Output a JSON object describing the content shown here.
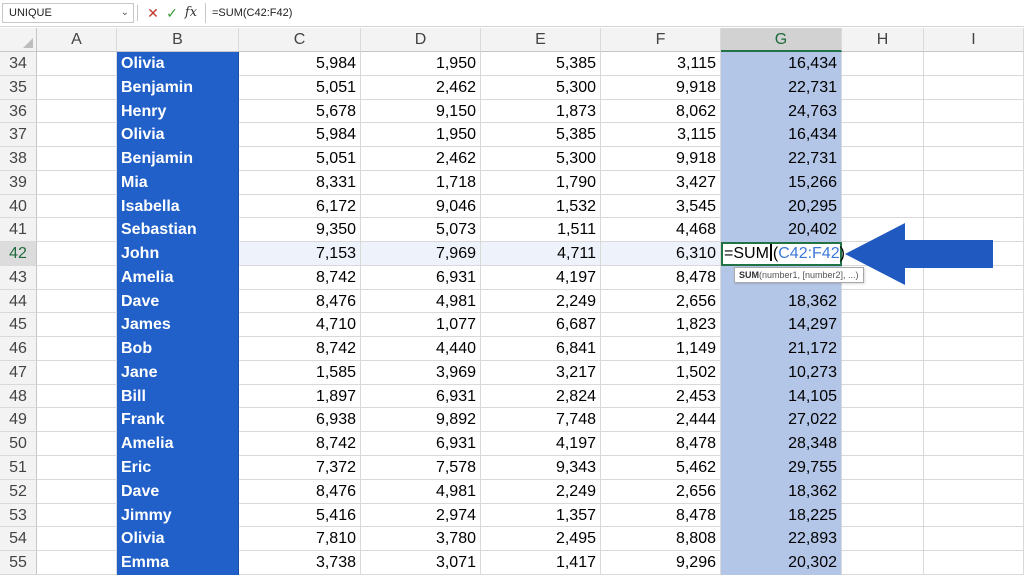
{
  "formula_bar": {
    "name_box": "UNIQUE",
    "cancel_icon": "✕",
    "enter_icon": "✓",
    "fx_label": "fx",
    "formula": "=SUM(C42:F42)"
  },
  "columns": [
    "A",
    "B",
    "C",
    "D",
    "E",
    "F",
    "G",
    "H",
    "I"
  ],
  "selected_column": "G",
  "selected_row": "42",
  "rows": [
    {
      "num": "34",
      "name": "Olivia",
      "c": "5,984",
      "d": "1,950",
      "e": "5,385",
      "f": "3,115",
      "g": "16,434"
    },
    {
      "num": "35",
      "name": "Benjamin",
      "c": "5,051",
      "d": "2,462",
      "e": "5,300",
      "f": "9,918",
      "g": "22,731"
    },
    {
      "num": "36",
      "name": "Henry",
      "c": "5,678",
      "d": "9,150",
      "e": "1,873",
      "f": "8,062",
      "g": "24,763"
    },
    {
      "num": "37",
      "name": "Olivia",
      "c": "5,984",
      "d": "1,950",
      "e": "5,385",
      "f": "3,115",
      "g": "16,434"
    },
    {
      "num": "38",
      "name": "Benjamin",
      "c": "5,051",
      "d": "2,462",
      "e": "5,300",
      "f": "9,918",
      "g": "22,731"
    },
    {
      "num": "39",
      "name": "Mia",
      "c": "8,331",
      "d": "1,718",
      "e": "1,790",
      "f": "3,427",
      "g": "15,266"
    },
    {
      "num": "40",
      "name": "Isabella",
      "c": "6,172",
      "d": "9,046",
      "e": "1,532",
      "f": "3,545",
      "g": "20,295"
    },
    {
      "num": "41",
      "name": "Sebastian",
      "c": "9,350",
      "d": "5,073",
      "e": "1,511",
      "f": "4,468",
      "g": "20,402"
    },
    {
      "num": "42",
      "name": "John",
      "c": "7,153",
      "d": "7,969",
      "e": "4,711",
      "f": "6,310",
      "g": ""
    },
    {
      "num": "43",
      "name": "Amelia",
      "c": "8,742",
      "d": "6,931",
      "e": "4,197",
      "f": "8,478",
      "g": ""
    },
    {
      "num": "44",
      "name": "Dave",
      "c": "8,476",
      "d": "4,981",
      "e": "2,249",
      "f": "2,656",
      "g": "18,362"
    },
    {
      "num": "45",
      "name": "James",
      "c": "4,710",
      "d": "1,077",
      "e": "6,687",
      "f": "1,823",
      "g": "14,297"
    },
    {
      "num": "46",
      "name": "Bob",
      "c": "8,742",
      "d": "4,440",
      "e": "6,841",
      "f": "1,149",
      "g": "21,172"
    },
    {
      "num": "47",
      "name": "Jane",
      "c": "1,585",
      "d": "3,969",
      "e": "3,217",
      "f": "1,502",
      "g": "10,273"
    },
    {
      "num": "48",
      "name": "Bill",
      "c": "1,897",
      "d": "6,931",
      "e": "2,824",
      "f": "2,453",
      "g": "14,105"
    },
    {
      "num": "49",
      "name": "Frank",
      "c": "6,938",
      "d": "9,892",
      "e": "7,748",
      "f": "2,444",
      "g": "27,022"
    },
    {
      "num": "50",
      "name": "Amelia",
      "c": "8,742",
      "d": "6,931",
      "e": "4,197",
      "f": "8,478",
      "g": "28,348"
    },
    {
      "num": "51",
      "name": "Eric",
      "c": "7,372",
      "d": "7,578",
      "e": "9,343",
      "f": "5,462",
      "g": "29,755"
    },
    {
      "num": "52",
      "name": "Dave",
      "c": "8,476",
      "d": "4,981",
      "e": "2,249",
      "f": "2,656",
      "g": "18,362"
    },
    {
      "num": "53",
      "name": "Jimmy",
      "c": "5,416",
      "d": "2,974",
      "e": "1,357",
      "f": "8,478",
      "g": "18,225"
    },
    {
      "num": "54",
      "name": "Olivia",
      "c": "7,810",
      "d": "3,780",
      "e": "2,495",
      "f": "8,808",
      "g": "22,893"
    },
    {
      "num": "55",
      "name": "Emma",
      "c": "3,738",
      "d": "3,071",
      "e": "1,417",
      "f": "9,296",
      "g": "20,302"
    }
  ],
  "active_cell": {
    "prefix": "=SUM",
    "paren_open": "(",
    "reference": "C42:F42",
    "paren_close": ")"
  },
  "tooltip": {
    "function": "SUM",
    "args": "(number1, [number2], ...)"
  },
  "colors": {
    "name_fill": "#2060c8",
    "total_fill": "#b4c6e7",
    "arrow": "#2059c0",
    "reference_text": "#3b78d8"
  }
}
